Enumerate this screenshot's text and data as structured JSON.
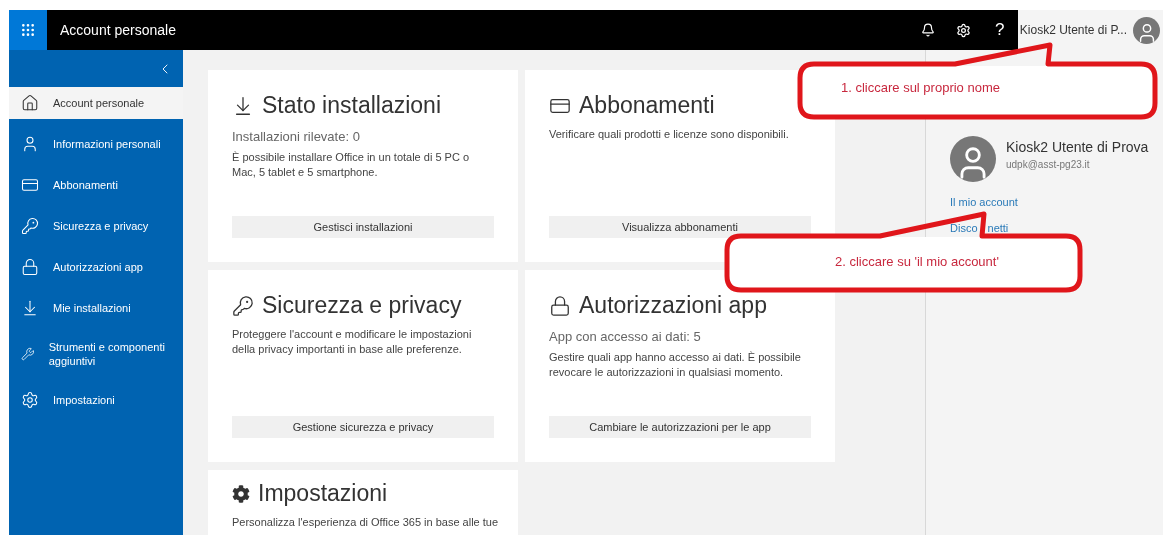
{
  "top_bar": {
    "title": "Account personale",
    "help": "?",
    "user_name": "Kiosk2 Utente di P..."
  },
  "sidebar": {
    "items": [
      {
        "label": "Account personale",
        "selected": true
      },
      {
        "label": "Informazioni personali",
        "selected": false
      },
      {
        "label": "Abbonamenti",
        "selected": false
      },
      {
        "label": "Sicurezza e privacy",
        "selected": false
      },
      {
        "label": "Autorizzazioni app",
        "selected": false
      },
      {
        "label": "Mie installazioni",
        "selected": false
      },
      {
        "label": "Strumenti e componenti aggiuntivi",
        "selected": false
      },
      {
        "label": "Impostazioni",
        "selected": false
      }
    ]
  },
  "cards": [
    {
      "title": "Stato installazioni",
      "subtitle": "Installazioni rilevate: 0",
      "description": "È possibile installare Office in un totale di 5 PC o Mac, 5 tablet e 5 smartphone.",
      "button": "Gestisci installazioni"
    },
    {
      "title": "Abbonamenti",
      "description": "Verificare quali prodotti e licenze sono disponibili.",
      "button": "Visualizza abbonamenti"
    },
    {
      "title": "Sicurezza e privacy",
      "description": "Proteggere l'account e modificare le impostazioni della privacy importanti in base alle preferenze.",
      "button": "Gestione sicurezza e privacy"
    },
    {
      "title": "Autorizzazioni app",
      "subtitle": "App con accesso ai dati: 5",
      "description": "Gestire quali app hanno accesso ai dati. È possibile revocare le autorizzazioni in qualsiasi momento.",
      "button": "Cambiare le autorizzazioni per le app"
    },
    {
      "title": "Impostazioni",
      "description": "Personalizza l'esperienza di Office 365 in base alle tue"
    }
  ],
  "account_panel": {
    "name": "Kiosk2 Utente di Prova",
    "email": "udpk@asst-pg23.it",
    "my_account_link": "Il mio account",
    "sign_out_parts": [
      "Disco",
      "netti"
    ]
  },
  "callouts": [
    {
      "text": "1. cliccare sul proprio nome"
    },
    {
      "text": "2. cliccare su 'il mio account'"
    }
  ]
}
